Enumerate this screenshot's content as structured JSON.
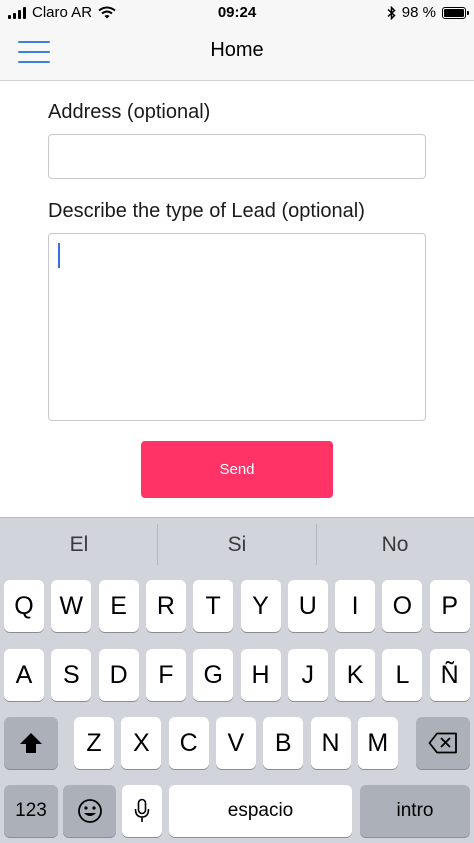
{
  "status_bar": {
    "carrier": "Claro AR",
    "time": "09:24",
    "battery": "98 %",
    "battery_level": 0.98,
    "icons": [
      "signal-icon",
      "wifi-icon",
      "bluetooth-icon",
      "battery-icon"
    ]
  },
  "nav": {
    "title": "Home",
    "menu_icon": "hamburger-menu-icon"
  },
  "form": {
    "address_label": "Address (optional)",
    "address_value": "",
    "lead_label": "Describe the type of Lead (optional)",
    "lead_value": "",
    "send_label": "Send"
  },
  "keyboard": {
    "suggestions": [
      "El",
      "Si",
      "No"
    ],
    "rows": [
      [
        "Q",
        "W",
        "E",
        "R",
        "T",
        "Y",
        "U",
        "I",
        "O",
        "P"
      ],
      [
        "A",
        "S",
        "D",
        "F",
        "G",
        "H",
        "J",
        "K",
        "L",
        "Ñ"
      ],
      [
        "Z",
        "X",
        "C",
        "V",
        "B",
        "N",
        "M"
      ]
    ],
    "numbers_label": "123",
    "space_label": "espacio",
    "return_label": "intro",
    "icons": [
      "shift-icon",
      "backspace-icon",
      "emoji-icon",
      "microphone-icon"
    ]
  },
  "colors": {
    "accent": "#3b82d6",
    "send_button": "#ff3366",
    "keyboard_bg": "#d1d4da"
  }
}
